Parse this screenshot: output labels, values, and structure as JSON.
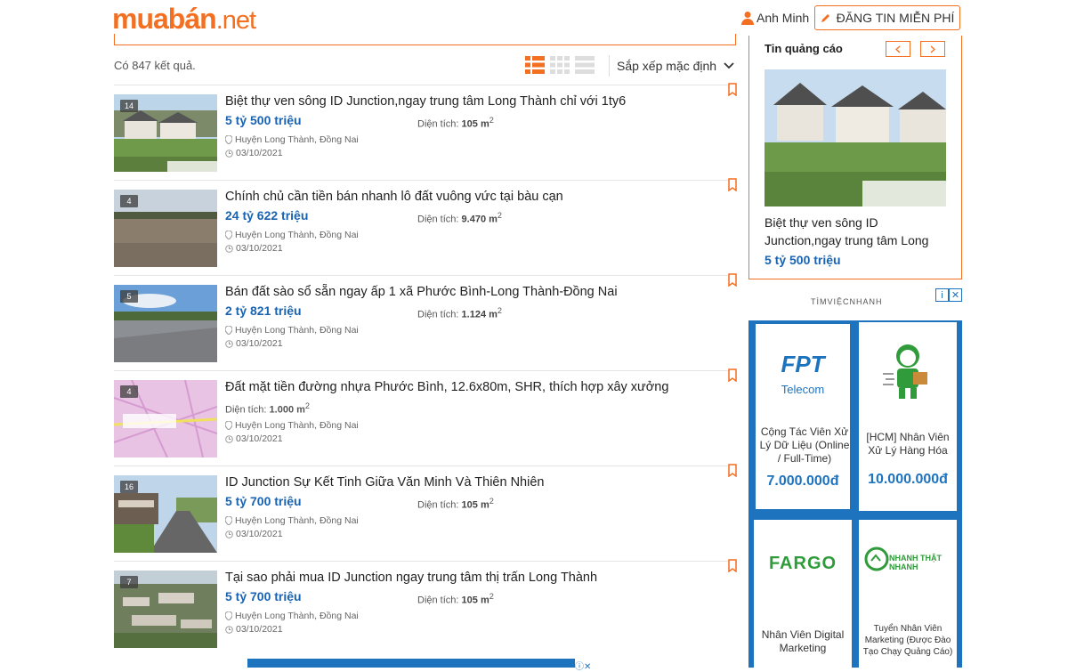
{
  "header": {
    "logo_main": "muabán",
    "logo_tld": ".net",
    "user_name": "Anh Minh",
    "post_button": "ĐĂNG TIN MIỄN PHÍ"
  },
  "toolbar": {
    "result_count": "Có 847 kết quả.",
    "sort_label": "Sắp xếp mặc định"
  },
  "listings": [
    {
      "badge": "14",
      "title": "Biệt thự ven sông ID Junction,ngay trung tâm Long Thành chỉ với 1ty6",
      "price": "5 tỷ 500 triệu",
      "area_label": "Diện tích:",
      "area_value": "105 m",
      "area_sup": "2",
      "location": "Huyện Long Thành, Đồng Nai",
      "date": "03/10/2021",
      "scene": "villa"
    },
    {
      "badge": "4",
      "title": "Chính chủ cần tiền bán nhanh lô đất vuông vức tại bàu cạn",
      "price": "24 tỷ 622 triệu",
      "area_label": "Diện tích:",
      "area_value": "9.470 m",
      "area_sup": "2",
      "location": "Huyện Long Thành, Đồng Nai",
      "date": "03/10/2021",
      "scene": "land"
    },
    {
      "badge": "5",
      "title": "Bán đất sào sổ sẵn ngay ấp 1 xã Phước Bình-Long Thành-Đồng Nai",
      "price": "2 tỷ 821 triệu",
      "area_label": "Diện tích:",
      "area_value": "1.124 m",
      "area_sup": "2",
      "location": "Huyện Long Thành, Đồng Nai",
      "date": "03/10/2021",
      "scene": "road"
    },
    {
      "badge": "4",
      "title": "Đất mặt tiền đường nhựa Phước Bình, 12.6x80m, SHR, thích hợp xây xưởng",
      "price": "",
      "area_label": "Diện tích:",
      "area_value": "1.000 m",
      "area_sup": "2",
      "location": "Huyện Long Thành, Đồng Nai",
      "date": "03/10/2021",
      "scene": "map"
    },
    {
      "badge": "16",
      "title": "ID Junction Sự Kết Tinh Giữa Văn Minh Và Thiên Nhiên",
      "price": "5 tỷ 700 triệu",
      "area_label": "Diện tích:",
      "area_value": "105 m",
      "area_sup": "2",
      "location": "Huyện Long Thành, Đồng Nai",
      "date": "03/10/2021",
      "scene": "street"
    },
    {
      "badge": "7",
      "title": "Tại sao phải mua ID Junction ngay trung tâm thị trấn Long Thành",
      "price": "5 tỷ 700 triệu",
      "area_label": "Diện tích:",
      "area_value": "105 m",
      "area_sup": "2",
      "location": "Huyện Long Thành, Đồng Nai",
      "date": "03/10/2021",
      "scene": "aerial"
    }
  ],
  "sidebar": {
    "title": "Tin quảng cáo",
    "ad_title": "Biệt thự ven sông ID Junction,ngay trung tâm Long",
    "ad_price": "5 tỷ 500 triệu"
  },
  "job_ad": {
    "brand": "TÌMVIỆCNHANH",
    "cards": [
      {
        "logo": "FPT",
        "logo_sub": "Telecom",
        "text": "Cộng Tác Viên Xử Lý Dữ Liệu (Online / Full-Time)",
        "salary": "7.000.000đ"
      },
      {
        "logo": "",
        "logo_sub": "",
        "text": "[HCM] Nhân Viên Xử Lý Hàng Hóa",
        "salary": "10.000.000đ"
      },
      {
        "logo": "FARGO",
        "logo_sub": "",
        "text": "Nhân Viên Digital Marketing",
        "salary": ""
      },
      {
        "logo": "NHANH THẬT NHANH",
        "logo_sub": "",
        "text": "Tuyển Nhân Viên Marketing (Được Đào Tạo Chạy Quảng Cáo)",
        "salary": ""
      }
    ]
  },
  "colors": {
    "brand": "#f36f21",
    "price": "#1a63b0",
    "ad_blue": "#1e73be"
  }
}
